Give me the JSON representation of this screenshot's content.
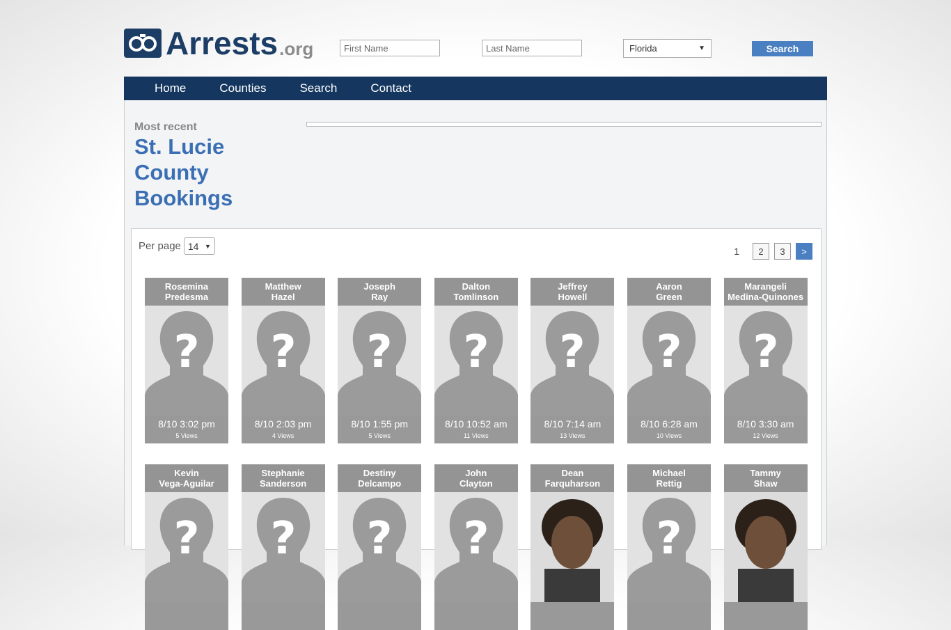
{
  "site": {
    "logo_main": "Arrests",
    "logo_suffix": ".org"
  },
  "search": {
    "first_name_placeholder": "First Name",
    "last_name_placeholder": "Last Name",
    "state": "Florida",
    "button": "Search"
  },
  "nav": {
    "items": [
      "Home",
      "Counties",
      "Search",
      "Contact"
    ]
  },
  "page": {
    "most_recent": "Most recent",
    "title": "St. Lucie County Bookings"
  },
  "controls": {
    "per_page_label": "Per page",
    "per_page_value": "14",
    "current_page": "1",
    "pages": [
      "2",
      "3"
    ],
    "next": ">"
  },
  "bookings": [
    {
      "first": "Rosemina",
      "last": "Predesma",
      "time": "8/10 3:02 pm",
      "views": "5 Views",
      "photo": "placeholder"
    },
    {
      "first": "Matthew",
      "last": "Hazel",
      "time": "8/10 2:03 pm",
      "views": "4 Views",
      "photo": "placeholder"
    },
    {
      "first": "Joseph",
      "last": "Ray",
      "time": "8/10 1:55 pm",
      "views": "5 Views",
      "photo": "placeholder"
    },
    {
      "first": "Dalton",
      "last": "Tomlinson",
      "time": "8/10 10:52 am",
      "views": "11 Views",
      "photo": "placeholder"
    },
    {
      "first": "Jeffrey",
      "last": "Howell",
      "time": "8/10 7:14 am",
      "views": "13 Views",
      "photo": "placeholder"
    },
    {
      "first": "Aaron",
      "last": "Green",
      "time": "8/10 6:28 am",
      "views": "10 Views",
      "photo": "placeholder"
    },
    {
      "first": "Marangeli",
      "last": "Medina-Quinones",
      "time": "8/10 3:30 am",
      "views": "12 Views",
      "photo": "placeholder"
    },
    {
      "first": "Kevin",
      "last": "Vega-Aguilar",
      "time": "",
      "views": "",
      "photo": "placeholder"
    },
    {
      "first": "Stephanie",
      "last": "Sanderson",
      "time": "",
      "views": "",
      "photo": "placeholder"
    },
    {
      "first": "Destiny",
      "last": "Delcampo",
      "time": "",
      "views": "",
      "photo": "placeholder"
    },
    {
      "first": "John",
      "last": "Clayton",
      "time": "",
      "views": "",
      "photo": "placeholder"
    },
    {
      "first": "Dean",
      "last": "Farquharson",
      "time": "",
      "views": "",
      "photo": "mugshot"
    },
    {
      "first": "Michael",
      "last": "Rettig",
      "time": "",
      "views": "",
      "photo": "placeholder"
    },
    {
      "first": "Tammy",
      "last": "Shaw",
      "time": "",
      "views": "",
      "photo": "mugshot"
    }
  ],
  "colors": {
    "nav_bg": "#14365f",
    "accent": "#4a7fc1",
    "title": "#3b6fb4"
  }
}
